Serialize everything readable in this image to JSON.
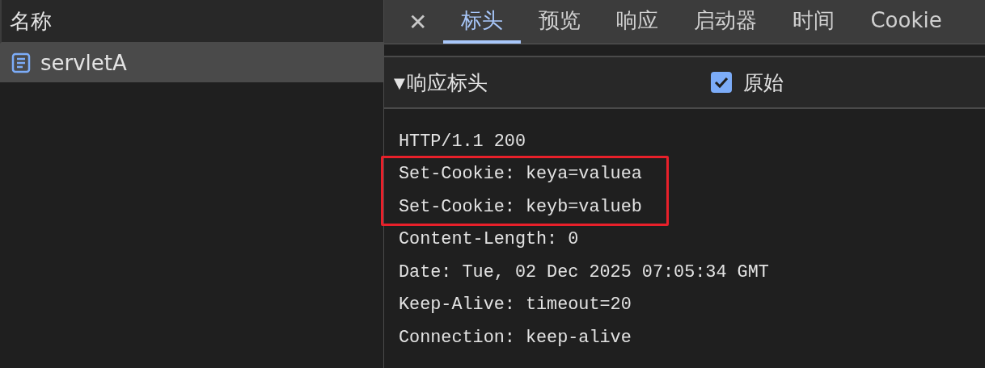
{
  "request_list": {
    "column_header": "名称",
    "rows": [
      {
        "name": "servletA",
        "selected": true
      }
    ]
  },
  "detail": {
    "close": "✕",
    "tabs": [
      {
        "label": "标头",
        "selected": true
      },
      {
        "label": "预览",
        "selected": false
      },
      {
        "label": "响应",
        "selected": false
      },
      {
        "label": "启动器",
        "selected": false
      },
      {
        "label": "时间",
        "selected": false
      },
      {
        "label": "Cookie",
        "selected": false
      }
    ],
    "section": {
      "toggle": "▼",
      "title": "响应标头",
      "expanded": true,
      "raw_label": "原始",
      "raw_checked": true,
      "lines": [
        {
          "text": "HTTP/1.1 200",
          "highlighted": false
        },
        {
          "text": "Set-Cookie: keya=valuea",
          "highlighted": true
        },
        {
          "text": "Set-Cookie: keyb=valueb",
          "highlighted": true
        },
        {
          "text": "Content-Length: 0",
          "highlighted": false
        },
        {
          "text": "Date: Tue, 02 Dec 2025 07:05:34 GMT",
          "highlighted": false
        },
        {
          "text": "Keep-Alive: timeout=20",
          "highlighted": false
        },
        {
          "text": "Connection: keep-alive",
          "highlighted": false
        }
      ]
    }
  }
}
